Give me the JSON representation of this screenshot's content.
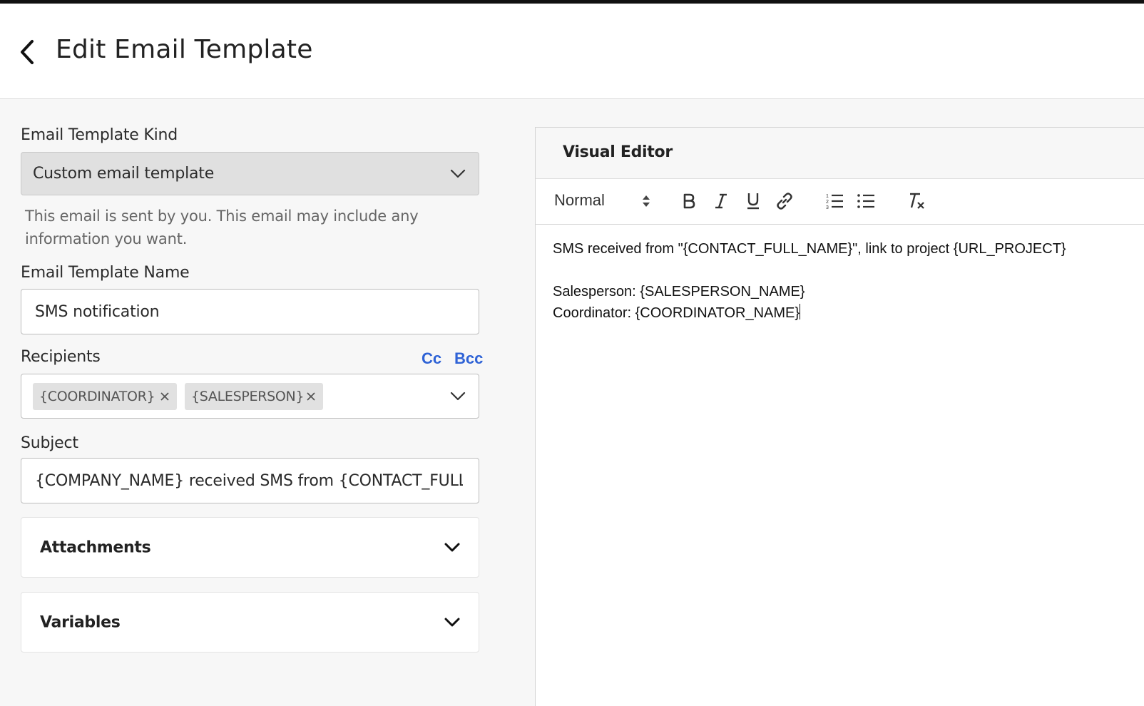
{
  "header": {
    "title": "Edit Email Template",
    "back_icon": "chevron-left-icon"
  },
  "form": {
    "kind": {
      "label": "Email Template Kind",
      "value": "Custom email template",
      "help_line1": "This email is sent by you. This email may include any",
      "help_line2": "information you want."
    },
    "name": {
      "label": "Email Template Name",
      "value": "SMS notification"
    },
    "recipients": {
      "label": "Recipients",
      "cc_label": "Cc",
      "bcc_label": "Bcc",
      "chips": [
        "{COORDINATOR}",
        "{SALESPERSON}"
      ]
    },
    "subject": {
      "label": "Subject",
      "value": "{COMPANY_NAME} received SMS from {CONTACT_FULL_NAME}"
    },
    "attachments_label": "Attachments",
    "variables_label": "Variables"
  },
  "editor": {
    "title": "Visual Editor",
    "format_value": "Normal",
    "toolbar": [
      "bold-icon",
      "italic-icon",
      "underline-icon",
      "link-icon",
      "ordered-list-icon",
      "bullet-list-icon",
      "clear-format-icon"
    ],
    "lines": [
      "SMS received from \"{CONTACT_FULL_NAME}\", link to project {URL_PROJECT}",
      "",
      "Salesperson: {SALESPERSON_NAME}",
      "Coordinator: {COORDINATOR_NAME}"
    ]
  },
  "colors": {
    "accent_link": "#2f63d6",
    "select_bg": "#e0e0e0",
    "chip_bg": "#e1e1e1"
  }
}
